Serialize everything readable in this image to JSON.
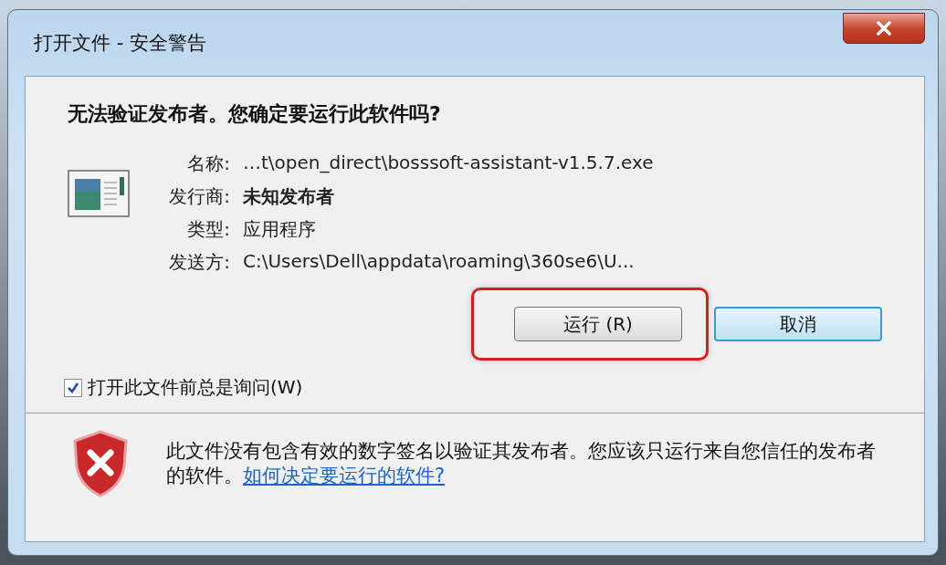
{
  "window": {
    "title": "打开文件 - 安全警告"
  },
  "heading": "无法验证发布者。您确定要运行此软件吗?",
  "details": [
    {
      "label": "名称:",
      "value": "…t\\open_direct\\bosssoft-assistant-v1.5.7.exe",
      "emphasized": false
    },
    {
      "label": "发行商:",
      "value": "未知发布者",
      "emphasized": true
    },
    {
      "label": "类型:",
      "value": "应用程序",
      "emphasized": false
    },
    {
      "label": "发送方:",
      "value": "C:\\Users\\Dell\\appdata\\roaming\\360se6\\U...",
      "emphasized": false
    }
  ],
  "buttons": [
    {
      "label": "运行 (R)",
      "highlighted": true,
      "default": false
    },
    {
      "label": "取消",
      "highlighted": false,
      "default": true
    }
  ],
  "checkbox": {
    "label": "打开此文件前总是询问(W)",
    "checked": true
  },
  "warning": {
    "text": "此文件没有包含有效的数字签名以验证其发布者。您应该只运行来自您信任的发布者的软件。",
    "link": "如何决定要运行的软件?"
  }
}
